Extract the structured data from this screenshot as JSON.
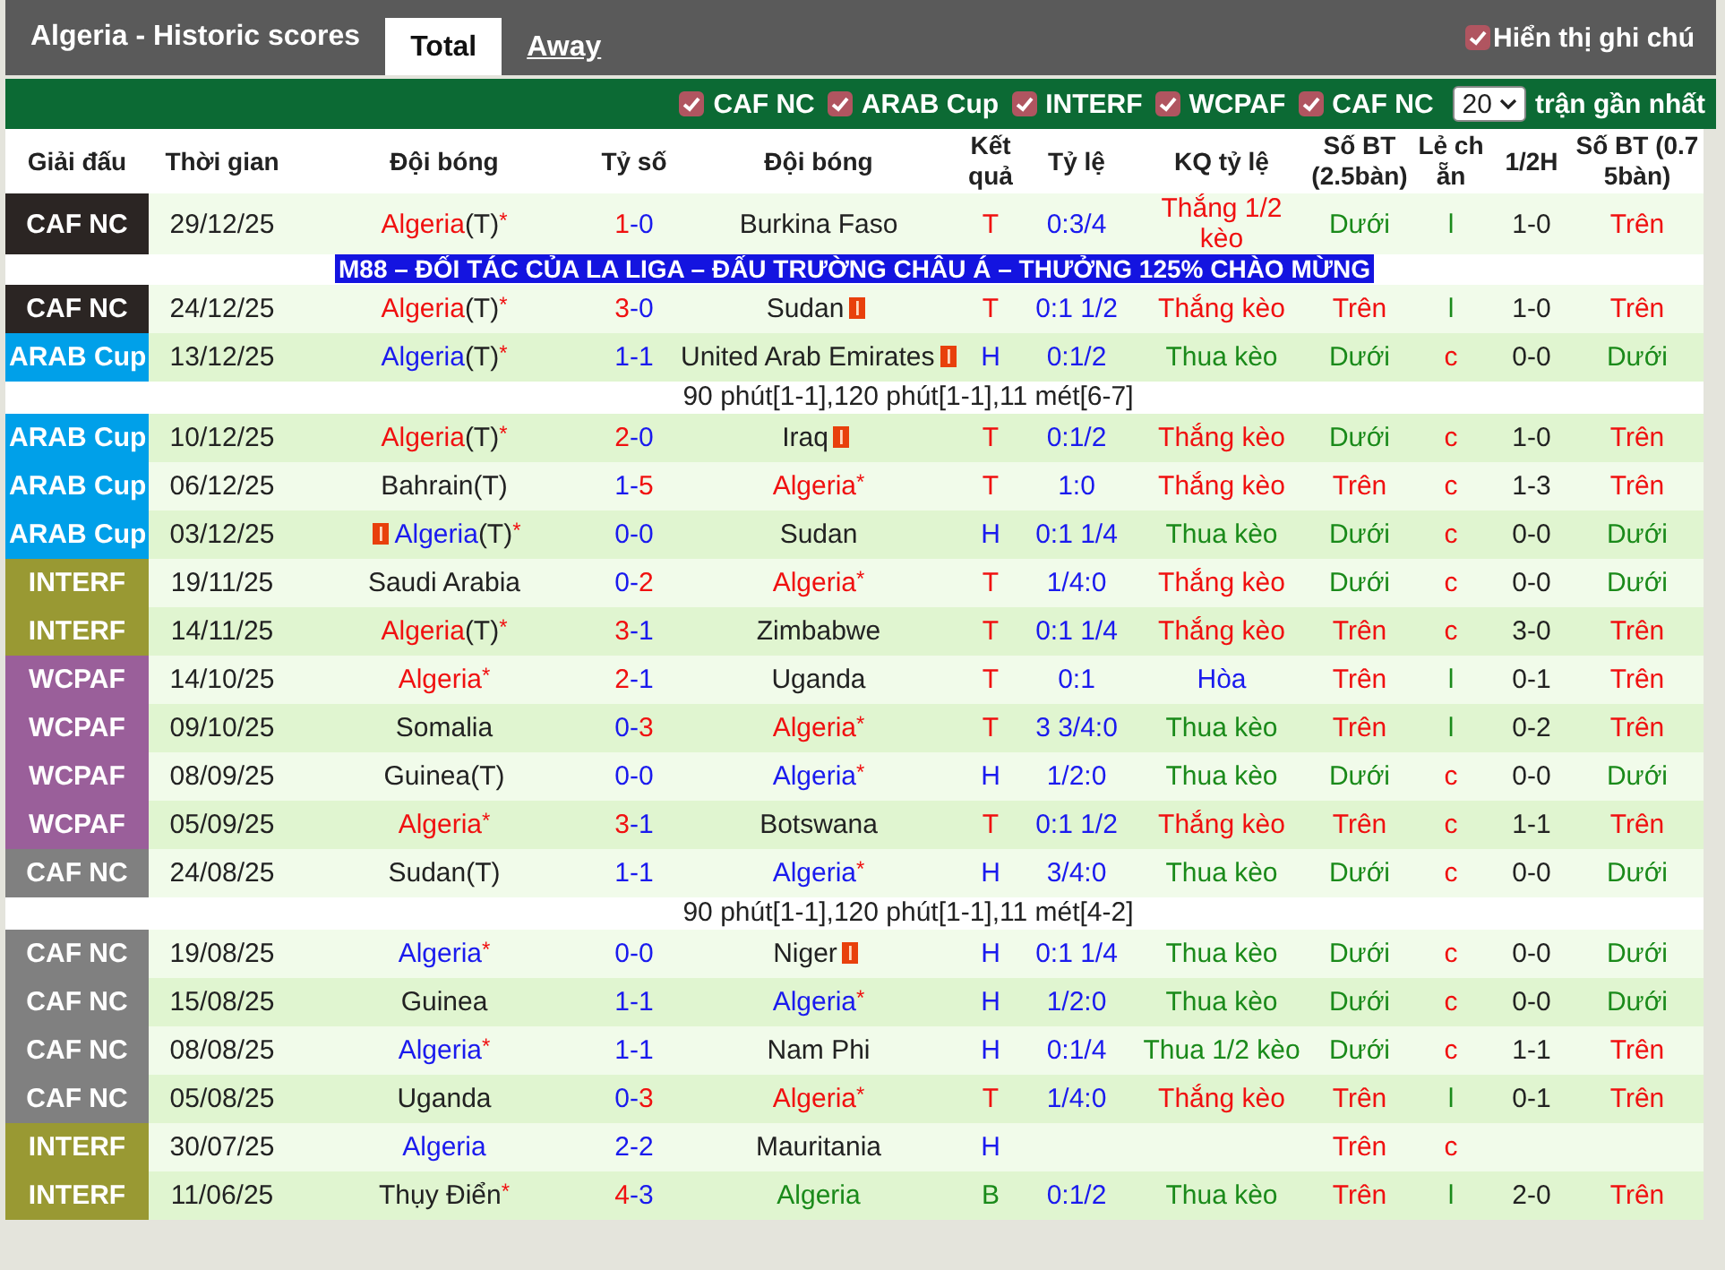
{
  "header": {
    "title": "Algeria - Historic scores",
    "tabs": [
      {
        "label": "Total",
        "selected": true
      },
      {
        "label": "Away",
        "selected": false
      }
    ],
    "show_notes": {
      "label": "Hiển thị ghi chú",
      "checked": true
    }
  },
  "filters": {
    "leagues": [
      {
        "label": "CAF NC",
        "checked": true
      },
      {
        "label": "ARAB Cup",
        "checked": true
      },
      {
        "label": "INTERF",
        "checked": true
      },
      {
        "label": "WCPAF",
        "checked": true
      },
      {
        "label": "CAF NC",
        "checked": true
      }
    ],
    "count": "20",
    "count_label": "trận gần nhất"
  },
  "columns": [
    "Giải đấu",
    "Thời gian",
    "Đội bóng",
    "Tỷ số",
    "Đội bóng",
    "Kết quả",
    "Tỷ lệ",
    "KQ tỷ lệ",
    "Số BT (2.5bàn)",
    "Lẻ chẵn",
    "1/2H",
    "Số BT (0.75bàn)"
  ],
  "rows": [
    {
      "kind": "match",
      "league": {
        "label": "CAF NC",
        "color": "#2b2523"
      },
      "date": "29/12/25",
      "home": {
        "name": "Algeria",
        "tag": "(T)",
        "mark": "*",
        "color": "#f01010"
      },
      "score": "1-0",
      "away": {
        "name": "Burkina Faso",
        "color": "#222222"
      },
      "result": {
        "text": "T",
        "color": "#f01010"
      },
      "handicap": "0:3/4",
      "handicap_result": {
        "text": "Thắng 1/2 kèo",
        "color": "#f01010"
      },
      "ou": {
        "text": "Dưới",
        "color": "#1a8a1a"
      },
      "oe": {
        "text": "l",
        "color": "#1a8a1a"
      },
      "ht": "1-0",
      "ou2": {
        "text": "Trên",
        "color": "#f01010"
      }
    },
    {
      "kind": "banner",
      "text": "M88 – ĐỐI TÁC CỦA LA LIGA – ĐẤU TRƯỜNG CHÂU Á – THƯỞNG 125% CHÀO MỪNG"
    },
    {
      "kind": "match",
      "league": {
        "label": "CAF NC",
        "color": "#2b2523"
      },
      "date": "24/12/25",
      "home": {
        "name": "Algeria",
        "tag": "(T)",
        "mark": "*",
        "color": "#f01010"
      },
      "score": "3-0",
      "away": {
        "name": "Sudan",
        "color": "#222222",
        "card_after": true
      },
      "result": {
        "text": "T",
        "color": "#f01010"
      },
      "handicap": "0:1 1/2",
      "handicap_result": {
        "text": "Thắng kèo",
        "color": "#f01010"
      },
      "ou": {
        "text": "Trên",
        "color": "#f01010"
      },
      "oe": {
        "text": "l",
        "color": "#1a8a1a"
      },
      "ht": "1-0",
      "ou2": {
        "text": "Trên",
        "color": "#f01010"
      }
    },
    {
      "kind": "match",
      "league": {
        "label": "ARAB Cup",
        "color": "#00a0e9"
      },
      "date": "13/12/25",
      "home": {
        "name": "Algeria",
        "tag": "(T)",
        "mark": "*",
        "color": "#1a1aee"
      },
      "score": "1-1",
      "away": {
        "name": "United Arab Emirates",
        "color": "#222222",
        "card_after": true
      },
      "result": {
        "text": "H",
        "color": "#1a1aee"
      },
      "handicap": "0:1/2",
      "handicap_result": {
        "text": "Thua kèo",
        "color": "#1a8a1a"
      },
      "ou": {
        "text": "Dưới",
        "color": "#1a8a1a"
      },
      "oe": {
        "text": "c",
        "color": "#f01010"
      },
      "ht": "0-0",
      "ou2": {
        "text": "Dưới",
        "color": "#1a8a1a"
      }
    },
    {
      "kind": "note",
      "text": "90 phút[1-1],120 phút[1-1],11 mét[6-7]"
    },
    {
      "kind": "match",
      "league": {
        "label": "ARAB Cup",
        "color": "#00a0e9"
      },
      "date": "10/12/25",
      "home": {
        "name": "Algeria",
        "tag": "(T)",
        "mark": "*",
        "color": "#f01010"
      },
      "score": "2-0",
      "away": {
        "name": "Iraq",
        "color": "#222222",
        "card_after": true
      },
      "result": {
        "text": "T",
        "color": "#f01010"
      },
      "handicap": "0:1/2",
      "handicap_result": {
        "text": "Thắng kèo",
        "color": "#f01010"
      },
      "ou": {
        "text": "Dưới",
        "color": "#1a8a1a"
      },
      "oe": {
        "text": "c",
        "color": "#f01010"
      },
      "ht": "1-0",
      "ou2": {
        "text": "Trên",
        "color": "#f01010"
      }
    },
    {
      "kind": "match",
      "league": {
        "label": "ARAB Cup",
        "color": "#00a0e9"
      },
      "date": "06/12/25",
      "home": {
        "name": "Bahrain",
        "tag": "(T)",
        "color": "#222222"
      },
      "score": "1-5",
      "away": {
        "name": "Algeria",
        "mark": "*",
        "color": "#f01010"
      },
      "result": {
        "text": "T",
        "color": "#f01010"
      },
      "handicap": "1:0",
      "handicap_result": {
        "text": "Thắng kèo",
        "color": "#f01010"
      },
      "ou": {
        "text": "Trên",
        "color": "#f01010"
      },
      "oe": {
        "text": "c",
        "color": "#f01010"
      },
      "ht": "1-3",
      "ou2": {
        "text": "Trên",
        "color": "#f01010"
      }
    },
    {
      "kind": "match",
      "league": {
        "label": "ARAB Cup",
        "color": "#00a0e9"
      },
      "date": "03/12/25",
      "home": {
        "name": "Algeria",
        "tag": "(T)",
        "mark": "*",
        "color": "#1a1aee",
        "card_before": true
      },
      "score": "0-0",
      "away": {
        "name": "Sudan",
        "color": "#222222"
      },
      "result": {
        "text": "H",
        "color": "#1a1aee"
      },
      "handicap": "0:1 1/4",
      "handicap_result": {
        "text": "Thua kèo",
        "color": "#1a8a1a"
      },
      "ou": {
        "text": "Dưới",
        "color": "#1a8a1a"
      },
      "oe": {
        "text": "c",
        "color": "#f01010"
      },
      "ht": "0-0",
      "ou2": {
        "text": "Dưới",
        "color": "#1a8a1a"
      }
    },
    {
      "kind": "match",
      "league": {
        "label": "INTERF",
        "color": "#999933"
      },
      "date": "19/11/25",
      "home": {
        "name": "Saudi Arabia",
        "color": "#222222"
      },
      "score": "0-2",
      "away": {
        "name": "Algeria",
        "mark": "*",
        "color": "#f01010"
      },
      "result": {
        "text": "T",
        "color": "#f01010"
      },
      "handicap": "1/4:0",
      "handicap_result": {
        "text": "Thắng kèo",
        "color": "#f01010"
      },
      "ou": {
        "text": "Dưới",
        "color": "#1a8a1a"
      },
      "oe": {
        "text": "c",
        "color": "#f01010"
      },
      "ht": "0-0",
      "ou2": {
        "text": "Dưới",
        "color": "#1a8a1a"
      }
    },
    {
      "kind": "match",
      "league": {
        "label": "INTERF",
        "color": "#999933"
      },
      "date": "14/11/25",
      "home": {
        "name": "Algeria",
        "tag": "(T)",
        "mark": "*",
        "color": "#f01010"
      },
      "score": "3-1",
      "away": {
        "name": "Zimbabwe",
        "color": "#222222"
      },
      "result": {
        "text": "T",
        "color": "#f01010"
      },
      "handicap": "0:1 1/4",
      "handicap_result": {
        "text": "Thắng kèo",
        "color": "#f01010"
      },
      "ou": {
        "text": "Trên",
        "color": "#f01010"
      },
      "oe": {
        "text": "c",
        "color": "#f01010"
      },
      "ht": "3-0",
      "ou2": {
        "text": "Trên",
        "color": "#f01010"
      }
    },
    {
      "kind": "match",
      "league": {
        "label": "WCPAF",
        "color": "#9a5f9a"
      },
      "date": "14/10/25",
      "home": {
        "name": "Algeria",
        "mark": "*",
        "color": "#f01010"
      },
      "score": "2-1",
      "away": {
        "name": "Uganda",
        "color": "#222222"
      },
      "result": {
        "text": "T",
        "color": "#f01010"
      },
      "handicap": "0:1",
      "handicap_result": {
        "text": "Hòa",
        "color": "#1a1aee"
      },
      "ou": {
        "text": "Trên",
        "color": "#f01010"
      },
      "oe": {
        "text": "l",
        "color": "#1a8a1a"
      },
      "ht": "0-1",
      "ou2": {
        "text": "Trên",
        "color": "#f01010"
      }
    },
    {
      "kind": "match",
      "league": {
        "label": "WCPAF",
        "color": "#9a5f9a"
      },
      "date": "09/10/25",
      "home": {
        "name": "Somalia",
        "color": "#222222"
      },
      "score": "0-3",
      "away": {
        "name": "Algeria",
        "mark": "*",
        "color": "#f01010"
      },
      "result": {
        "text": "T",
        "color": "#f01010"
      },
      "handicap": "3 3/4:0",
      "handicap_result": {
        "text": "Thua kèo",
        "color": "#1a8a1a"
      },
      "ou": {
        "text": "Trên",
        "color": "#f01010"
      },
      "oe": {
        "text": "l",
        "color": "#1a8a1a"
      },
      "ht": "0-2",
      "ou2": {
        "text": "Trên",
        "color": "#f01010"
      }
    },
    {
      "kind": "match",
      "league": {
        "label": "WCPAF",
        "color": "#9a5f9a"
      },
      "date": "08/09/25",
      "home": {
        "name": "Guinea",
        "tag": "(T)",
        "color": "#222222"
      },
      "score": "0-0",
      "away": {
        "name": "Algeria",
        "mark": "*",
        "color": "#1a1aee"
      },
      "result": {
        "text": "H",
        "color": "#1a1aee"
      },
      "handicap": "1/2:0",
      "handicap_result": {
        "text": "Thua kèo",
        "color": "#1a8a1a"
      },
      "ou": {
        "text": "Dưới",
        "color": "#1a8a1a"
      },
      "oe": {
        "text": "c",
        "color": "#f01010"
      },
      "ht": "0-0",
      "ou2": {
        "text": "Dưới",
        "color": "#1a8a1a"
      }
    },
    {
      "kind": "match",
      "league": {
        "label": "WCPAF",
        "color": "#9a5f9a"
      },
      "date": "05/09/25",
      "home": {
        "name": "Algeria",
        "mark": "*",
        "color": "#f01010"
      },
      "score": "3-1",
      "away": {
        "name": "Botswana",
        "color": "#222222"
      },
      "result": {
        "text": "T",
        "color": "#f01010"
      },
      "handicap": "0:1 1/2",
      "handicap_result": {
        "text": "Thắng kèo",
        "color": "#f01010"
      },
      "ou": {
        "text": "Trên",
        "color": "#f01010"
      },
      "oe": {
        "text": "c",
        "color": "#f01010"
      },
      "ht": "1-1",
      "ou2": {
        "text": "Trên",
        "color": "#f01010"
      }
    },
    {
      "kind": "match",
      "league": {
        "label": "CAF NC",
        "color": "#808080"
      },
      "date": "24/08/25",
      "home": {
        "name": "Sudan",
        "tag": "(T)",
        "color": "#222222"
      },
      "score": "1-1",
      "away": {
        "name": "Algeria",
        "mark": "*",
        "color": "#1a1aee"
      },
      "result": {
        "text": "H",
        "color": "#1a1aee"
      },
      "handicap": "3/4:0",
      "handicap_result": {
        "text": "Thua kèo",
        "color": "#1a8a1a"
      },
      "ou": {
        "text": "Dưới",
        "color": "#1a8a1a"
      },
      "oe": {
        "text": "c",
        "color": "#f01010"
      },
      "ht": "0-0",
      "ou2": {
        "text": "Dưới",
        "color": "#1a8a1a"
      }
    },
    {
      "kind": "note",
      "text": "90 phút[1-1],120 phút[1-1],11 mét[4-2]"
    },
    {
      "kind": "match",
      "league": {
        "label": "CAF NC",
        "color": "#808080"
      },
      "date": "19/08/25",
      "home": {
        "name": "Algeria",
        "mark": "*",
        "color": "#1a1aee"
      },
      "score": "0-0",
      "away": {
        "name": "Niger",
        "color": "#222222",
        "card_after": true
      },
      "result": {
        "text": "H",
        "color": "#1a1aee"
      },
      "handicap": "0:1 1/4",
      "handicap_result": {
        "text": "Thua kèo",
        "color": "#1a8a1a"
      },
      "ou": {
        "text": "Dưới",
        "color": "#1a8a1a"
      },
      "oe": {
        "text": "c",
        "color": "#f01010"
      },
      "ht": "0-0",
      "ou2": {
        "text": "Dưới",
        "color": "#1a8a1a"
      }
    },
    {
      "kind": "match",
      "league": {
        "label": "CAF NC",
        "color": "#808080"
      },
      "date": "15/08/25",
      "home": {
        "name": "Guinea",
        "color": "#222222"
      },
      "score": "1-1",
      "away": {
        "name": "Algeria",
        "mark": "*",
        "color": "#1a1aee"
      },
      "result": {
        "text": "H",
        "color": "#1a1aee"
      },
      "handicap": "1/2:0",
      "handicap_result": {
        "text": "Thua kèo",
        "color": "#1a8a1a"
      },
      "ou": {
        "text": "Dưới",
        "color": "#1a8a1a"
      },
      "oe": {
        "text": "c",
        "color": "#f01010"
      },
      "ht": "0-0",
      "ou2": {
        "text": "Dưới",
        "color": "#1a8a1a"
      }
    },
    {
      "kind": "match",
      "league": {
        "label": "CAF NC",
        "color": "#808080"
      },
      "date": "08/08/25",
      "home": {
        "name": "Algeria",
        "mark": "*",
        "color": "#1a1aee"
      },
      "score": "1-1",
      "away": {
        "name": "Nam Phi",
        "color": "#222222"
      },
      "result": {
        "text": "H",
        "color": "#1a1aee"
      },
      "handicap": "0:1/4",
      "handicap_result": {
        "text": "Thua 1/2 kèo",
        "color": "#1a8a1a"
      },
      "ou": {
        "text": "Dưới",
        "color": "#1a8a1a"
      },
      "oe": {
        "text": "c",
        "color": "#f01010"
      },
      "ht": "1-1",
      "ou2": {
        "text": "Trên",
        "color": "#f01010"
      }
    },
    {
      "kind": "match",
      "league": {
        "label": "CAF NC",
        "color": "#808080"
      },
      "date": "05/08/25",
      "home": {
        "name": "Uganda",
        "color": "#222222"
      },
      "score": "0-3",
      "away": {
        "name": "Algeria",
        "mark": "*",
        "color": "#f01010"
      },
      "result": {
        "text": "T",
        "color": "#f01010"
      },
      "handicap": "1/4:0",
      "handicap_result": {
        "text": "Thắng kèo",
        "color": "#f01010"
      },
      "ou": {
        "text": "Trên",
        "color": "#f01010"
      },
      "oe": {
        "text": "l",
        "color": "#1a8a1a"
      },
      "ht": "0-1",
      "ou2": {
        "text": "Trên",
        "color": "#f01010"
      }
    },
    {
      "kind": "match",
      "league": {
        "label": "INTERF",
        "color": "#999933"
      },
      "date": "30/07/25",
      "home": {
        "name": "Algeria",
        "color": "#1a1aee"
      },
      "score": "2-2",
      "away": {
        "name": "Mauritania",
        "color": "#222222"
      },
      "result": {
        "text": "H",
        "color": "#1a1aee"
      },
      "ou": {
        "text": "Trên",
        "color": "#f01010"
      },
      "oe": {
        "text": "c",
        "color": "#f01010"
      }
    },
    {
      "kind": "match",
      "league": {
        "label": "INTERF",
        "color": "#999933"
      },
      "date": "11/06/25",
      "home": {
        "name": "Thụy Điển",
        "mark": "*",
        "color": "#222222"
      },
      "score": "4-3",
      "away": {
        "name": "Algeria",
        "color": "#1a8a1a"
      },
      "result": {
        "text": "B",
        "color": "#1a8a1a"
      },
      "handicap": "0:1/2",
      "handicap_result": {
        "text": "Thua kèo",
        "color": "#1a8a1a"
      },
      "ou": {
        "text": "Trên",
        "color": "#f01010"
      },
      "oe": {
        "text": "l",
        "color": "#1a8a1a"
      },
      "ht": "2-0",
      "ou2": {
        "text": "Trên",
        "color": "#f01010"
      }
    }
  ]
}
